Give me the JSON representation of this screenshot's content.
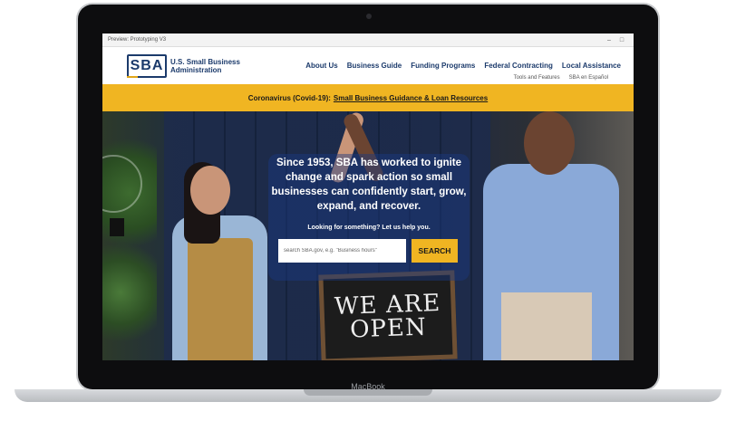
{
  "device": {
    "label": "MacBook"
  },
  "window": {
    "title": "Preview: Prototyping V3",
    "minimize": "–",
    "maximize": "□"
  },
  "header": {
    "logo_mark": "SBA",
    "logo_line1": "U.S. Small Business",
    "logo_line2": "Administration",
    "nav": [
      "About Us",
      "Business Guide",
      "Funding Programs",
      "Federal Contracting",
      "Local Assistance"
    ],
    "subnav": [
      "Tools and Features",
      "SBA en Español"
    ]
  },
  "banner": {
    "prefix": "Coronavirus (Covid-19):",
    "link": "Small Business Guidance & Loan Resources"
  },
  "hero": {
    "headline": "Since 1953, SBA has worked to ignite change and spark action so small businesses can confidently start, grow, expand, and recover.",
    "help_label": "Looking for something? Let us help you.",
    "search_placeholder": "search SBA.gov, e.g. \"Business hours\"",
    "search_button": "SEARCH",
    "sign_line1": "WE ARE",
    "sign_line2": "OPEN"
  },
  "colors": {
    "navy": "#1b3a6b",
    "gold": "#f0b522"
  }
}
